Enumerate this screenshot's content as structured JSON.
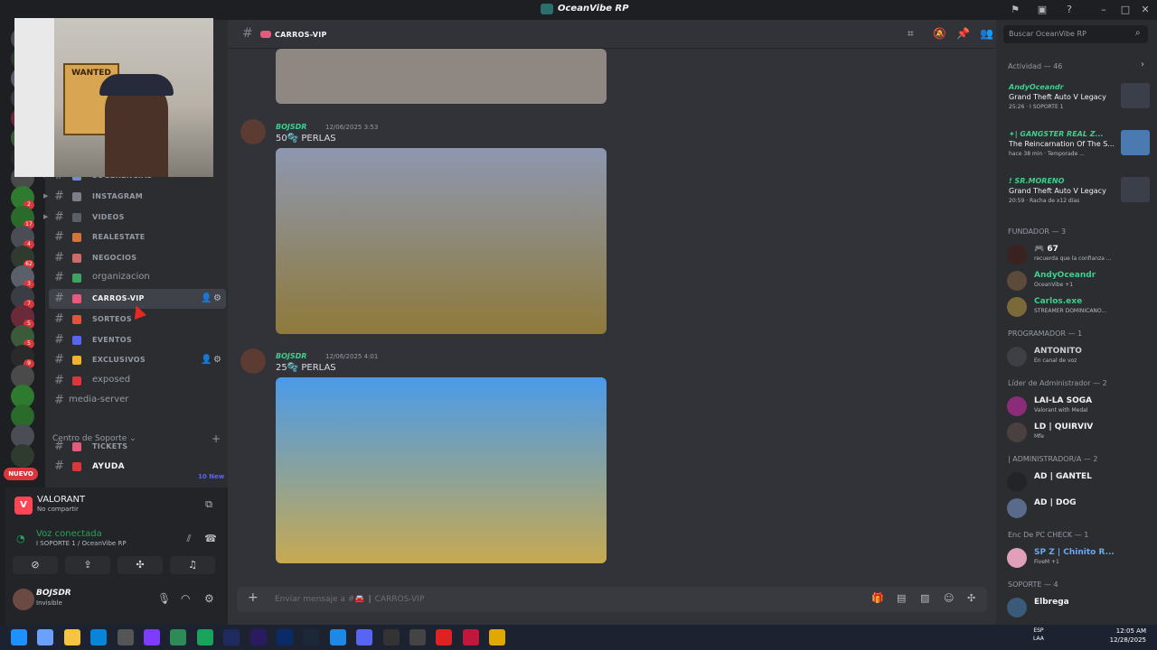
{
  "window": {
    "title": "OceanVibe RP"
  },
  "webcam": {
    "poster_text": "WANTED"
  },
  "server_badges": [
    "2",
    "17",
    "4",
    "62",
    "3",
    "7",
    "5",
    "5",
    "9"
  ],
  "channels": {
    "items": [
      {
        "label": "SUGERENCIAS",
        "style": "caps",
        "color": "#7289da",
        "icon": "bulb-icon"
      },
      {
        "label": "INSTAGRAM",
        "style": "caps",
        "color": "#7a7f89",
        "icon": "camera-icon"
      },
      {
        "label": "VIDEOS",
        "style": "caps",
        "color": "#5b5f68",
        "icon": "video-icon"
      },
      {
        "label": "REALESTATE",
        "style": "caps",
        "color": "#d2763a",
        "icon": "house-icon"
      },
      {
        "label": "NEGOCIOS",
        "style": "caps",
        "color": "#ce6a6a",
        "icon": "shop-icon"
      },
      {
        "label": "organizacion",
        "style": "lower",
        "color": "#3ba55d",
        "icon": "flag-icon"
      },
      {
        "label": "CARROS-VIP",
        "style": "caps",
        "color": "#e45b7d",
        "icon": "car-icon",
        "selected": true
      },
      {
        "label": "SORTEOS",
        "style": "caps",
        "color": "#e0533d",
        "icon": "gift-icon"
      },
      {
        "label": "EVENTOS",
        "style": "caps",
        "color": "#5865f2",
        "icon": "calendar-icon"
      },
      {
        "label": "EXCLUSIVOS",
        "style": "caps",
        "color": "#f0b232",
        "icon": "star-icon"
      },
      {
        "label": "exposed",
        "style": "lower",
        "color": "#da373c",
        "icon": "no-entry-icon"
      },
      {
        "label": "media-server",
        "style": "plain",
        "color": "",
        "icon": ""
      }
    ],
    "category": "Centro de Soporte",
    "support": [
      {
        "label": "TICKETS",
        "color": "#e45b7d"
      },
      {
        "label": "AYUDA",
        "color": "#da373c"
      }
    ],
    "nuevo": "NUEVO",
    "new_count": "10 New"
  },
  "panel": {
    "game_name": "VALORANT",
    "game_sub": "No compartir",
    "voice_title": "Voz conectada",
    "voice_sub": "I SOPORTE 1 / OceanVibe RP",
    "user_name": "BOJSDR",
    "user_status": "Invisible"
  },
  "header": {
    "channel": "CARROS-VIP"
  },
  "messages": [
    {
      "author": "BOJSDR",
      "time": "12/06/2025 3:53",
      "text": "50🫧 PERLAS",
      "img_top": "#8d97b0",
      "img_bottom": "#8f7a3a"
    },
    {
      "author": "BOJSDR",
      "time": "12/06/2025 4:01",
      "text": "25🫧 PERLAS",
      "img_top": "#4a9bea",
      "img_bottom": "#c7a951"
    }
  ],
  "composer": {
    "placeholder": "Enviar mensaje a #🚘 ┃ CARROS-VIP"
  },
  "members": {
    "search_placeholder": "Buscar OceanVibe RP",
    "activity_title": "Actividad — 46",
    "activity": [
      {
        "name": "AndyOceandr",
        "game": "Grand Theft Auto V Legacy",
        "meta": "25:26  ·  I SOPORTE 1",
        "color": "#3ecf8e",
        "thumb": "#3a3f4a"
      },
      {
        "name": "✦| GANGSTER REAL Z...",
        "game": "The Reincarnation Of The S...",
        "meta": "hace 38 min  ·  Temporade ...",
        "color": "#3ecf8e",
        "thumb": "#4a7ab0"
      },
      {
        "name": "! SR.MORENO",
        "game": "Grand Theft Auto V Legacy",
        "meta": "20:59  ·  Racha de x12 días",
        "color": "#3ecf8e",
        "thumb": "#3a3f4a"
      }
    ],
    "roles": [
      {
        "title": "FUNDADOR — 3",
        "members": [
          {
            "name": "🎮 67",
            "sub": "recuerda que la confianza ...",
            "color": "#f2f3f5",
            "av": "#3a2220"
          },
          {
            "name": "AndyOceandr",
            "sub": "OceanVibe +1",
            "color": "#3ecf8e",
            "av": "#5c4b3a"
          },
          {
            "name": "Carlos.exe",
            "sub": "STREAMER DOMINICANO...",
            "color": "#3ecf8e",
            "av": "#7a6a3a"
          }
        ]
      },
      {
        "title": "PROGRAMADOR — 1",
        "members": [
          {
            "name": "ANTONITO",
            "sub": "En canal de voz",
            "color": "#c9cdd4",
            "av": "#3d3f44"
          }
        ]
      },
      {
        "title": "Líder de Administrador — 2",
        "members": [
          {
            "name": "LAI-LA SOGA",
            "sub": "Valorant with Medal",
            "color": "#f2f3f5",
            "av": "#8a2c7a"
          },
          {
            "name": "LD | QUIRVIV",
            "sub": "Mfe",
            "color": "#f2f3f5",
            "av": "#4a4040"
          }
        ]
      },
      {
        "title": "| ADMINISTRADOR/A — 2",
        "members": [
          {
            "name": "AD | GANTEL",
            "sub": "",
            "color": "#f2f3f5",
            "av": "#222428"
          },
          {
            "name": "AD | DOG",
            "sub": "",
            "color": "#f2f3f5",
            "av": "#5a6a8a"
          }
        ]
      },
      {
        "title": "Enc De PC CHECK — 1",
        "members": [
          {
            "name": "SP Z | Chinito R...",
            "sub": "FiveM +1",
            "color": "#6aa8f0",
            "av": "#e0a0b8"
          }
        ]
      },
      {
        "title": "SOPORTE — 4",
        "members": [
          {
            "name": "Elbrega",
            "sub": "",
            "color": "#f2f3f5",
            "av": "#3a5a7a"
          }
        ]
      }
    ]
  },
  "taskbar": {
    "lang": "ESP\nLAA",
    "time": "12:05 AM",
    "date": "12/28/2025"
  },
  "colors": {
    "accent": "#5865f2",
    "online": "#23a55a",
    "danger": "#da373c"
  }
}
